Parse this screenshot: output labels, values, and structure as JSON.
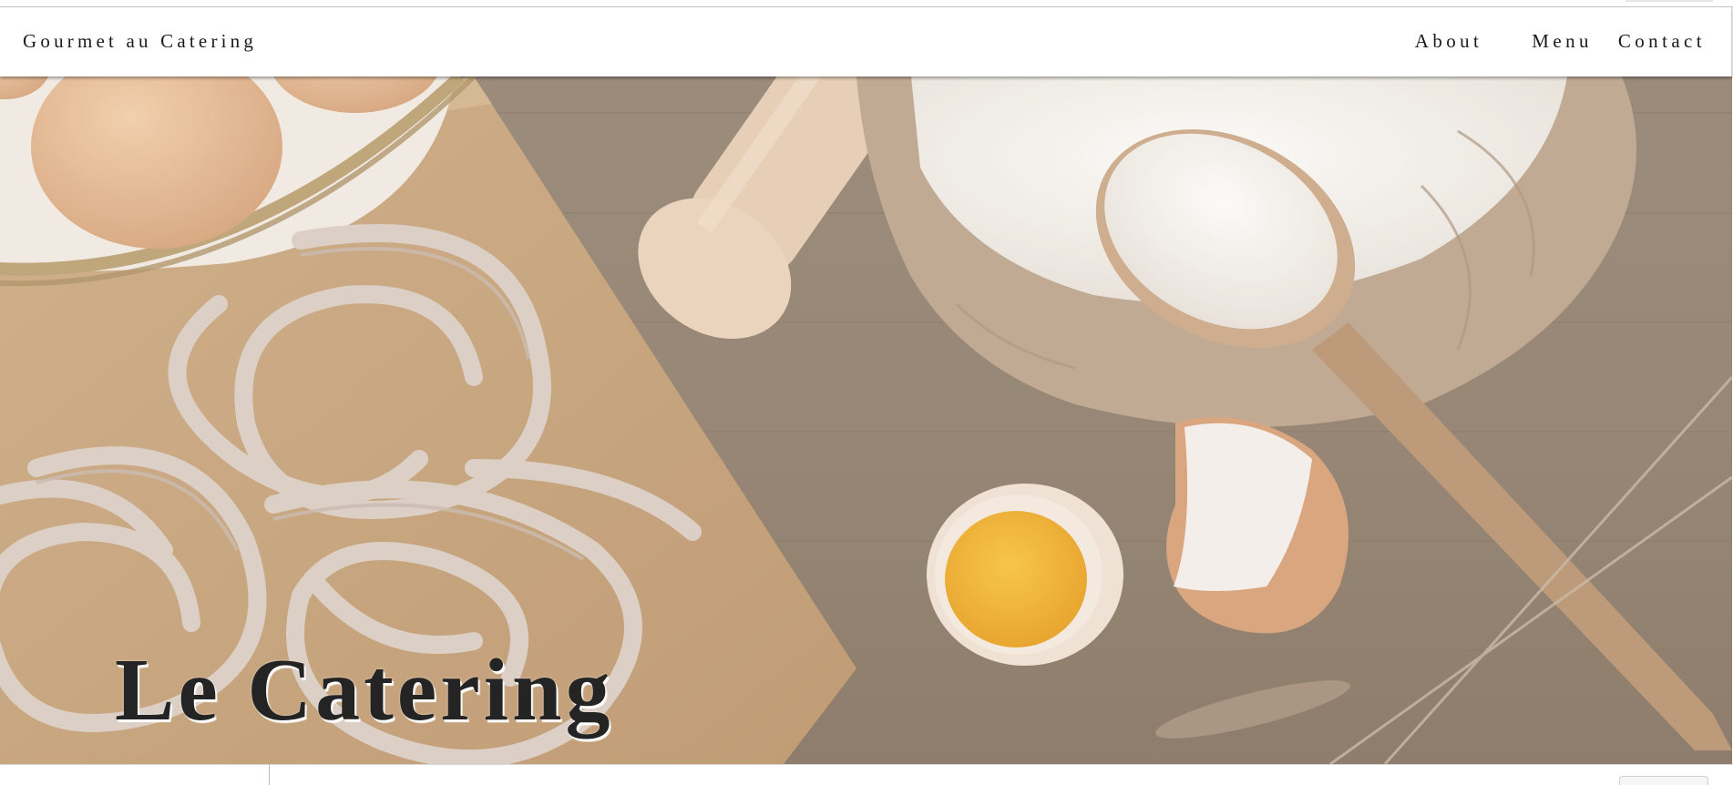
{
  "nav": {
    "brand": "Gourmet au Catering",
    "links": [
      {
        "label": "About"
      },
      {
        "label": "Menu"
      },
      {
        "label": "Contact"
      }
    ]
  },
  "hero": {
    "title": "Le Catering",
    "background_icon": "food-ingredients-photo"
  },
  "colors": {
    "nav_background": "#ffffff",
    "nav_text": "#1a1a1a",
    "hero_wood": "#8a7764",
    "title_text": "#242424"
  }
}
